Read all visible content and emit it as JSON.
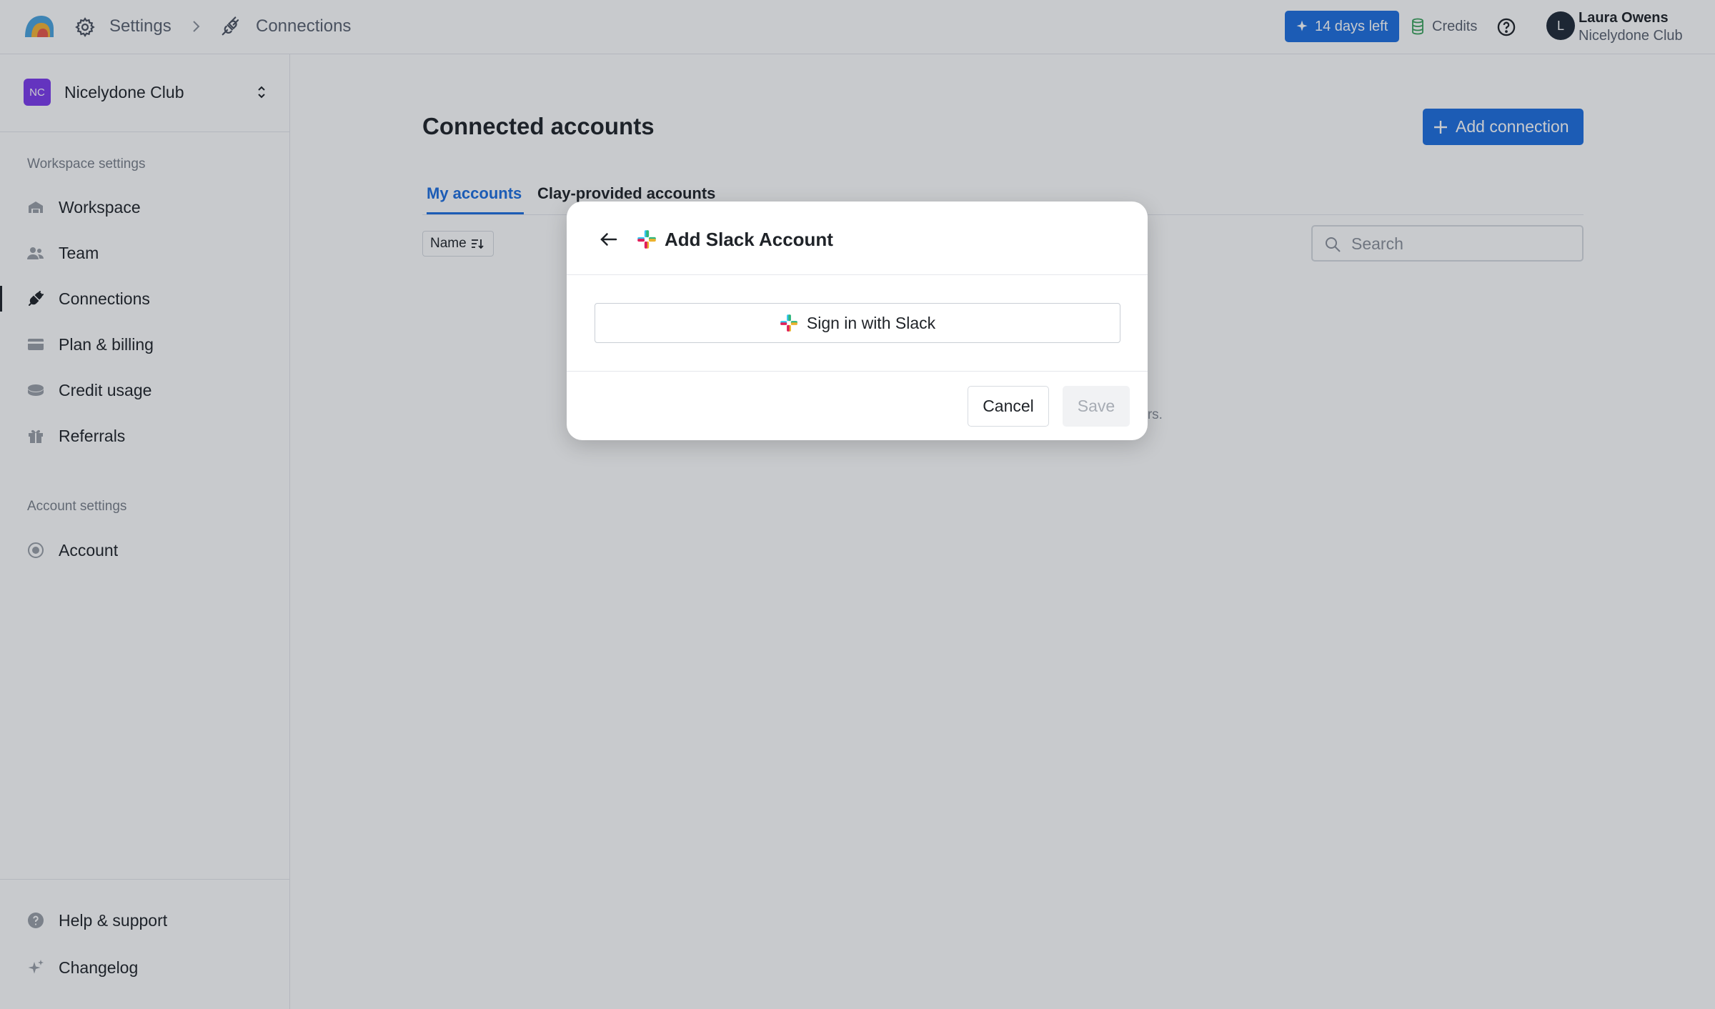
{
  "topbar": {
    "breadcrumb": [
      "Settings",
      "Connections"
    ],
    "trial_label": "14 days left",
    "credits_label": "Credits",
    "user": {
      "initial": "L",
      "name": "Laura Owens",
      "org": "Nicelydone Club"
    }
  },
  "sidebar": {
    "workspace": {
      "badge": "NC",
      "name": "Nicelydone Club"
    },
    "workspace_section": "Workspace settings",
    "workspace_items": [
      {
        "label": "Workspace",
        "icon": "building-icon"
      },
      {
        "label": "Team",
        "icon": "users-icon"
      },
      {
        "label": "Connections",
        "icon": "plug-icon",
        "active": true
      },
      {
        "label": "Plan & billing",
        "icon": "credit-card-icon"
      },
      {
        "label": "Credit usage",
        "icon": "coins-icon"
      },
      {
        "label": "Referrals",
        "icon": "gift-icon"
      }
    ],
    "account_section": "Account settings",
    "account_items": [
      {
        "label": "Account",
        "icon": "user-circle-icon"
      }
    ],
    "footer_items": [
      {
        "label": "Help & support",
        "icon": "help-circle-icon"
      },
      {
        "label": "Changelog",
        "icon": "sparkle-icon"
      }
    ]
  },
  "main": {
    "title": "Connected accounts",
    "add_button": "Add connection",
    "tabs": [
      "My accounts",
      "Clay-provided accounts"
    ],
    "sort_label": "Name",
    "search_placeholder": "Search",
    "empty_partial": "ters."
  },
  "modal": {
    "title": "Add Slack Account",
    "signin_label": "Sign in with Slack",
    "cancel_label": "Cancel",
    "save_label": "Save"
  },
  "colors": {
    "accent": "#1d6fe0",
    "workspace_badge": "#7c3aed",
    "overlay": "rgba(26,32,44,0.24)"
  }
}
